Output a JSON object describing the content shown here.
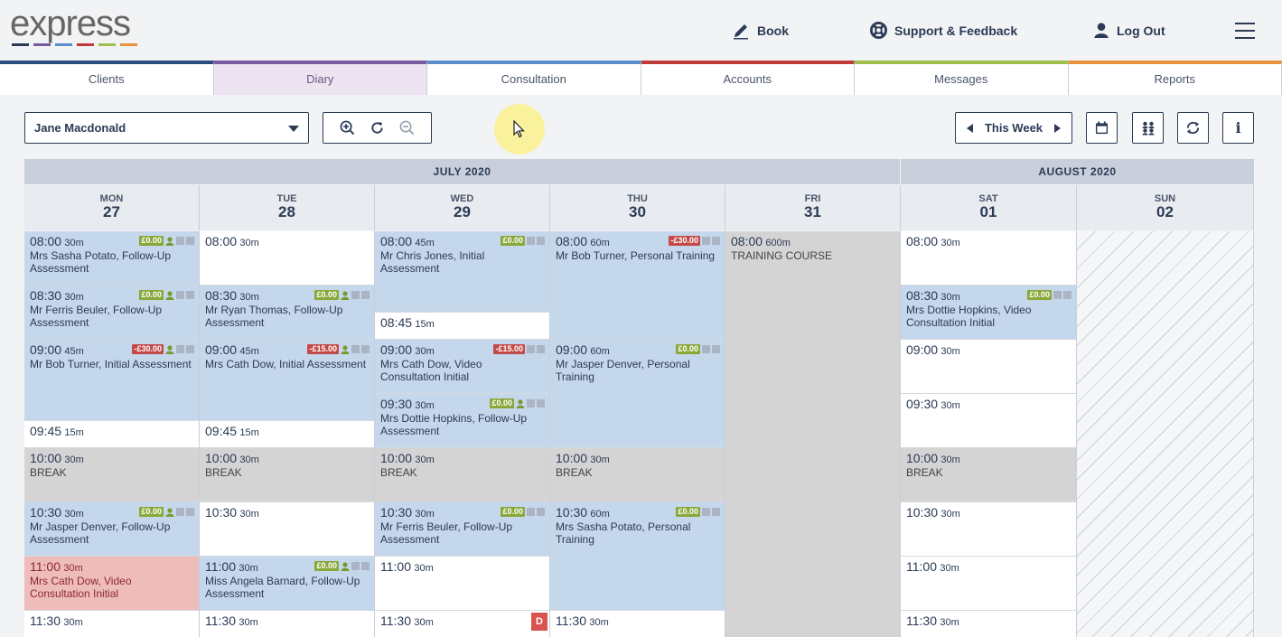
{
  "header": {
    "logo": "express",
    "logo_colors": [
      "#2b3a55",
      "#7a5a9e",
      "#5b8cc8",
      "#c03a3a",
      "#9cc04a",
      "#e8923a"
    ],
    "book_label": "Book",
    "support_label": "Support & Feedback",
    "logout_label": "Log Out"
  },
  "tabs": [
    {
      "label": "Clients",
      "color": "#2b4a7e",
      "active": false
    },
    {
      "label": "Diary",
      "color": "#7a5a9e",
      "active": true
    },
    {
      "label": "Consultation",
      "color": "#5b8cc8",
      "active": false
    },
    {
      "label": "Accounts",
      "color": "#c03a3a",
      "active": false
    },
    {
      "label": "Messages",
      "color": "#9cc04a",
      "active": false
    },
    {
      "label": "Reports",
      "color": "#e8923a",
      "active": false
    }
  ],
  "toolbar": {
    "practitioner": "Jane Macdonald",
    "week_label": "This Week",
    "info_label": "i"
  },
  "calendar": {
    "months": [
      {
        "label": "JULY 2020"
      },
      {
        "label": "AUGUST 2020"
      }
    ],
    "days": [
      {
        "name": "MON",
        "date": "27"
      },
      {
        "name": "TUE",
        "date": "28"
      },
      {
        "name": "WED",
        "date": "29"
      },
      {
        "name": "THU",
        "date": "30"
      },
      {
        "name": "FRI",
        "date": "31"
      },
      {
        "name": "SAT",
        "date": "01"
      },
      {
        "name": "SUN",
        "date": "02"
      }
    ],
    "columns": [
      [
        {
          "time": "08:00",
          "dur": "30m",
          "desc": "Mrs Sasha Potato, Follow-Up Assessment",
          "type": "appt",
          "amount": "£0.00",
          "sign": "pos",
          "person": true,
          "start": 0,
          "span": 1
        },
        {
          "time": "08:30",
          "dur": "30m",
          "desc": "Mr Ferris Beuler, Follow-Up Assessment",
          "type": "appt",
          "amount": "£0.00",
          "sign": "pos",
          "person": true,
          "start": 1,
          "span": 1
        },
        {
          "time": "09:00",
          "dur": "45m",
          "desc": "Mr Bob Turner, Initial Assessment",
          "type": "appt",
          "amount": "-£30.00",
          "sign": "neg",
          "person": true,
          "start": 2,
          "span": 1.5
        },
        {
          "time": "09:45",
          "dur": "15m",
          "desc": "",
          "type": "free",
          "start": 3.5,
          "span": 0.5
        },
        {
          "time": "10:00",
          "dur": "30m",
          "desc": "BREAK",
          "type": "brk",
          "start": 4,
          "span": 1
        },
        {
          "time": "10:30",
          "dur": "30m",
          "desc": "Mr Jasper Denver, Follow-Up Assessment",
          "type": "appt",
          "amount": "£0.00",
          "sign": "pos",
          "person": true,
          "start": 5,
          "span": 1
        },
        {
          "time": "11:00",
          "dur": "30m",
          "desc": "Mrs Cath Dow, Video Consultation Initial",
          "type": "pink",
          "start": 6,
          "span": 1
        },
        {
          "time": "11:30",
          "dur": "30m",
          "desc": "",
          "type": "free",
          "start": 7,
          "span": 1
        }
      ],
      [
        {
          "time": "08:00",
          "dur": "30m",
          "desc": "",
          "type": "free",
          "start": 0,
          "span": 1
        },
        {
          "time": "08:30",
          "dur": "30m",
          "desc": "Mr Ryan Thomas, Follow-Up Assessment",
          "type": "appt",
          "amount": "£0.00",
          "sign": "pos",
          "person": true,
          "start": 1,
          "span": 1
        },
        {
          "time": "09:00",
          "dur": "45m",
          "desc": "Mrs Cath Dow, Initial Assessment",
          "type": "appt",
          "amount": "-£15.00",
          "sign": "neg",
          "person": true,
          "start": 2,
          "span": 1.5
        },
        {
          "time": "09:45",
          "dur": "15m",
          "desc": "",
          "type": "free",
          "start": 3.5,
          "span": 0.5
        },
        {
          "time": "10:00",
          "dur": "30m",
          "desc": "BREAK",
          "type": "brk",
          "start": 4,
          "span": 1
        },
        {
          "time": "10:30",
          "dur": "30m",
          "desc": "",
          "type": "free",
          "start": 5,
          "span": 1
        },
        {
          "time": "11:00",
          "dur": "30m",
          "desc": "Miss Angela Barnard, Follow-Up Assessment",
          "type": "appt",
          "amount": "£0.00",
          "sign": "pos",
          "person": true,
          "start": 6,
          "span": 1
        },
        {
          "time": "11:30",
          "dur": "30m",
          "desc": "",
          "type": "free",
          "start": 7,
          "span": 1
        }
      ],
      [
        {
          "time": "08:00",
          "dur": "45m",
          "desc": "Mr Chris Jones, Initial Assessment",
          "type": "appt",
          "amount": "£0.00",
          "sign": "pos",
          "person": false,
          "start": 0,
          "span": 1.5
        },
        {
          "time": "08:45",
          "dur": "15m",
          "desc": "",
          "type": "free",
          "start": 1.5,
          "span": 0.5
        },
        {
          "time": "09:00",
          "dur": "30m",
          "desc": "Mrs Cath Dow, Video Consultation Initial",
          "type": "appt",
          "amount": "-£15.00",
          "sign": "neg",
          "person": false,
          "start": 2,
          "span": 1
        },
        {
          "time": "09:30",
          "dur": "30m",
          "desc": "Mrs Dottie Hopkins, Follow-Up Assessment",
          "type": "appt",
          "amount": "£0.00",
          "sign": "pos",
          "person": true,
          "start": 3,
          "span": 1
        },
        {
          "time": "10:00",
          "dur": "30m",
          "desc": "BREAK",
          "type": "brk",
          "start": 4,
          "span": 1
        },
        {
          "time": "10:30",
          "dur": "30m",
          "desc": "Mr Ferris Beuler, Follow-Up Assessment",
          "type": "appt",
          "amount": "£0.00",
          "sign": "pos",
          "person": false,
          "start": 5,
          "span": 1
        },
        {
          "time": "11:00",
          "dur": "30m",
          "desc": "",
          "type": "free",
          "start": 6,
          "span": 1
        },
        {
          "time": "11:30",
          "dur": "30m",
          "desc": "",
          "type": "free",
          "start": 7,
          "span": 1,
          "badge": "D"
        }
      ],
      [
        {
          "time": "08:00",
          "dur": "60m",
          "desc": "Mr Bob Turner, Personal Training",
          "type": "appt",
          "amount": "-£30.00",
          "sign": "neg",
          "person": false,
          "start": 0,
          "span": 2
        },
        {
          "time": "09:00",
          "dur": "60m",
          "desc": "Mr Jasper Denver, Personal Training",
          "type": "appt",
          "amount": "£0.00",
          "sign": "pos",
          "person": false,
          "start": 2,
          "span": 2
        },
        {
          "time": "10:00",
          "dur": "30m",
          "desc": "BREAK",
          "type": "brk",
          "start": 4,
          "span": 1
        },
        {
          "time": "10:30",
          "dur": "60m",
          "desc": "Mrs Sasha Potato, Personal Training",
          "type": "appt",
          "amount": "£0.00",
          "sign": "pos",
          "person": false,
          "start": 5,
          "span": 2
        },
        {
          "time": "11:30",
          "dur": "30m",
          "desc": "",
          "type": "free",
          "start": 7,
          "span": 1
        }
      ],
      [
        {
          "time": "08:00",
          "dur": "600m",
          "desc": "TRAINING COURSE",
          "type": "grey",
          "start": 0,
          "span": 8
        }
      ],
      [
        {
          "time": "08:00",
          "dur": "30m",
          "desc": "",
          "type": "free",
          "start": 0,
          "span": 1
        },
        {
          "time": "08:30",
          "dur": "30m",
          "desc": "Mrs Dottie Hopkins, Video Consultation Initial",
          "type": "appt",
          "amount": "£0.00",
          "sign": "pos",
          "person": false,
          "start": 1,
          "span": 1
        },
        {
          "time": "09:00",
          "dur": "30m",
          "desc": "",
          "type": "free",
          "start": 2,
          "span": 1
        },
        {
          "time": "09:30",
          "dur": "30m",
          "desc": "",
          "type": "free",
          "start": 3,
          "span": 1
        },
        {
          "time": "10:00",
          "dur": "30m",
          "desc": "BREAK",
          "type": "brk",
          "start": 4,
          "span": 1
        },
        {
          "time": "10:30",
          "dur": "30m",
          "desc": "",
          "type": "free",
          "start": 5,
          "span": 1
        },
        {
          "time": "11:00",
          "dur": "30m",
          "desc": "",
          "type": "free",
          "start": 6,
          "span": 1
        },
        {
          "time": "11:30",
          "dur": "30m",
          "desc": "",
          "type": "free",
          "start": 7,
          "span": 1
        }
      ],
      []
    ]
  }
}
